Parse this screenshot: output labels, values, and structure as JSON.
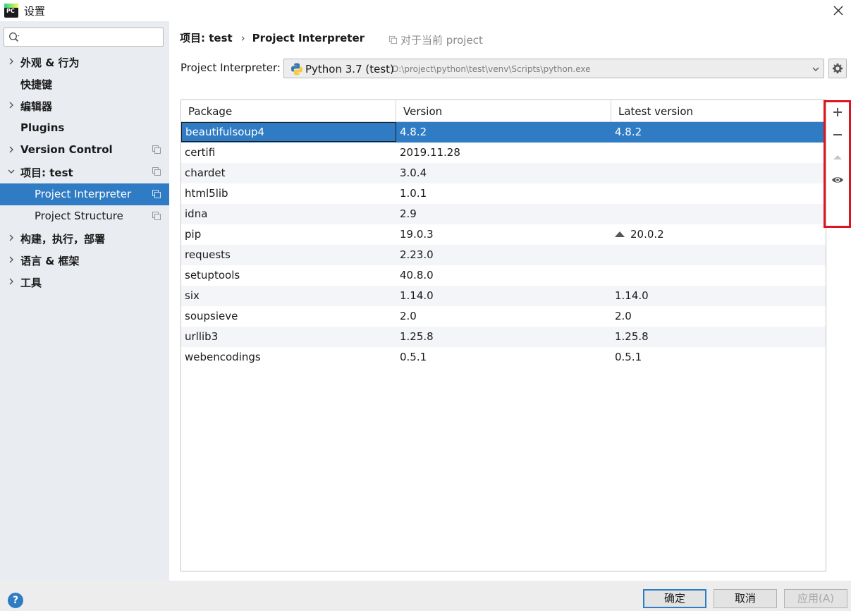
{
  "window": {
    "app_icon_text": "PC",
    "title": "设置"
  },
  "sidebar": {
    "search": {
      "placeholder": "",
      "value": ""
    },
    "items": [
      {
        "label": "外观 & 行为",
        "expandable": true,
        "expanded": false
      },
      {
        "label": "快捷键",
        "expandable": false
      },
      {
        "label": "编辑器",
        "expandable": true,
        "expanded": false
      },
      {
        "label": "Plugins",
        "expandable": false
      },
      {
        "label": "Version Control",
        "expandable": true,
        "expanded": false,
        "project_level": true
      },
      {
        "label": "项目: test",
        "expandable": true,
        "expanded": true,
        "project_level": true
      },
      {
        "label": "Project Interpreter",
        "child": true,
        "selected": true,
        "project_level": true
      },
      {
        "label": "Project Structure",
        "child": true,
        "project_level": true
      },
      {
        "label": "构建，执行，部署",
        "expandable": true,
        "expanded": false
      },
      {
        "label": "语言 & 框架",
        "expandable": true,
        "expanded": false
      },
      {
        "label": "工具",
        "expandable": true,
        "expanded": false
      }
    ]
  },
  "header": {
    "breadcrumb": [
      "项目: test",
      "Project Interpreter"
    ],
    "breadcrumb_separator": "›",
    "scope_note": "对于当前 project"
  },
  "interpreter": {
    "label": "Project Interpreter:",
    "name": "Python 3.7 (test)",
    "path": "D:\\project\\python\\test\\venv\\Scripts\\python.exe"
  },
  "packages": {
    "columns": [
      "Package",
      "Version",
      "Latest version"
    ],
    "rows": [
      {
        "package": "beautifulsoup4",
        "version": "4.8.2",
        "latest": "4.8.2",
        "selected": true
      },
      {
        "package": "certifi",
        "version": "2019.11.28",
        "latest": ""
      },
      {
        "package": "chardet",
        "version": "3.0.4",
        "latest": ""
      },
      {
        "package": "html5lib",
        "version": "1.0.1",
        "latest": ""
      },
      {
        "package": "idna",
        "version": "2.9",
        "latest": ""
      },
      {
        "package": "pip",
        "version": "19.0.3",
        "latest": "20.0.2",
        "upgrade": true
      },
      {
        "package": "requests",
        "version": "2.23.0",
        "latest": ""
      },
      {
        "package": "setuptools",
        "version": "40.8.0",
        "latest": ""
      },
      {
        "package": "six",
        "version": "1.14.0",
        "latest": "1.14.0"
      },
      {
        "package": "soupsieve",
        "version": "2.0",
        "latest": "2.0"
      },
      {
        "package": "urllib3",
        "version": "1.25.8",
        "latest": "1.25.8"
      },
      {
        "package": "webencodings",
        "version": "0.5.1",
        "latest": "0.5.1"
      }
    ]
  },
  "toolbar": {
    "icons": [
      "plus-icon",
      "minus-icon",
      "upgrade-icon",
      "eye-icon"
    ],
    "highlight_color": "#e0141e"
  },
  "footer": {
    "help": "?",
    "ok": "确定",
    "cancel": "取消",
    "apply": "应用(A)"
  },
  "colors": {
    "selection": "#2f7cc4",
    "sidebar_bg": "#e9ecf1"
  }
}
